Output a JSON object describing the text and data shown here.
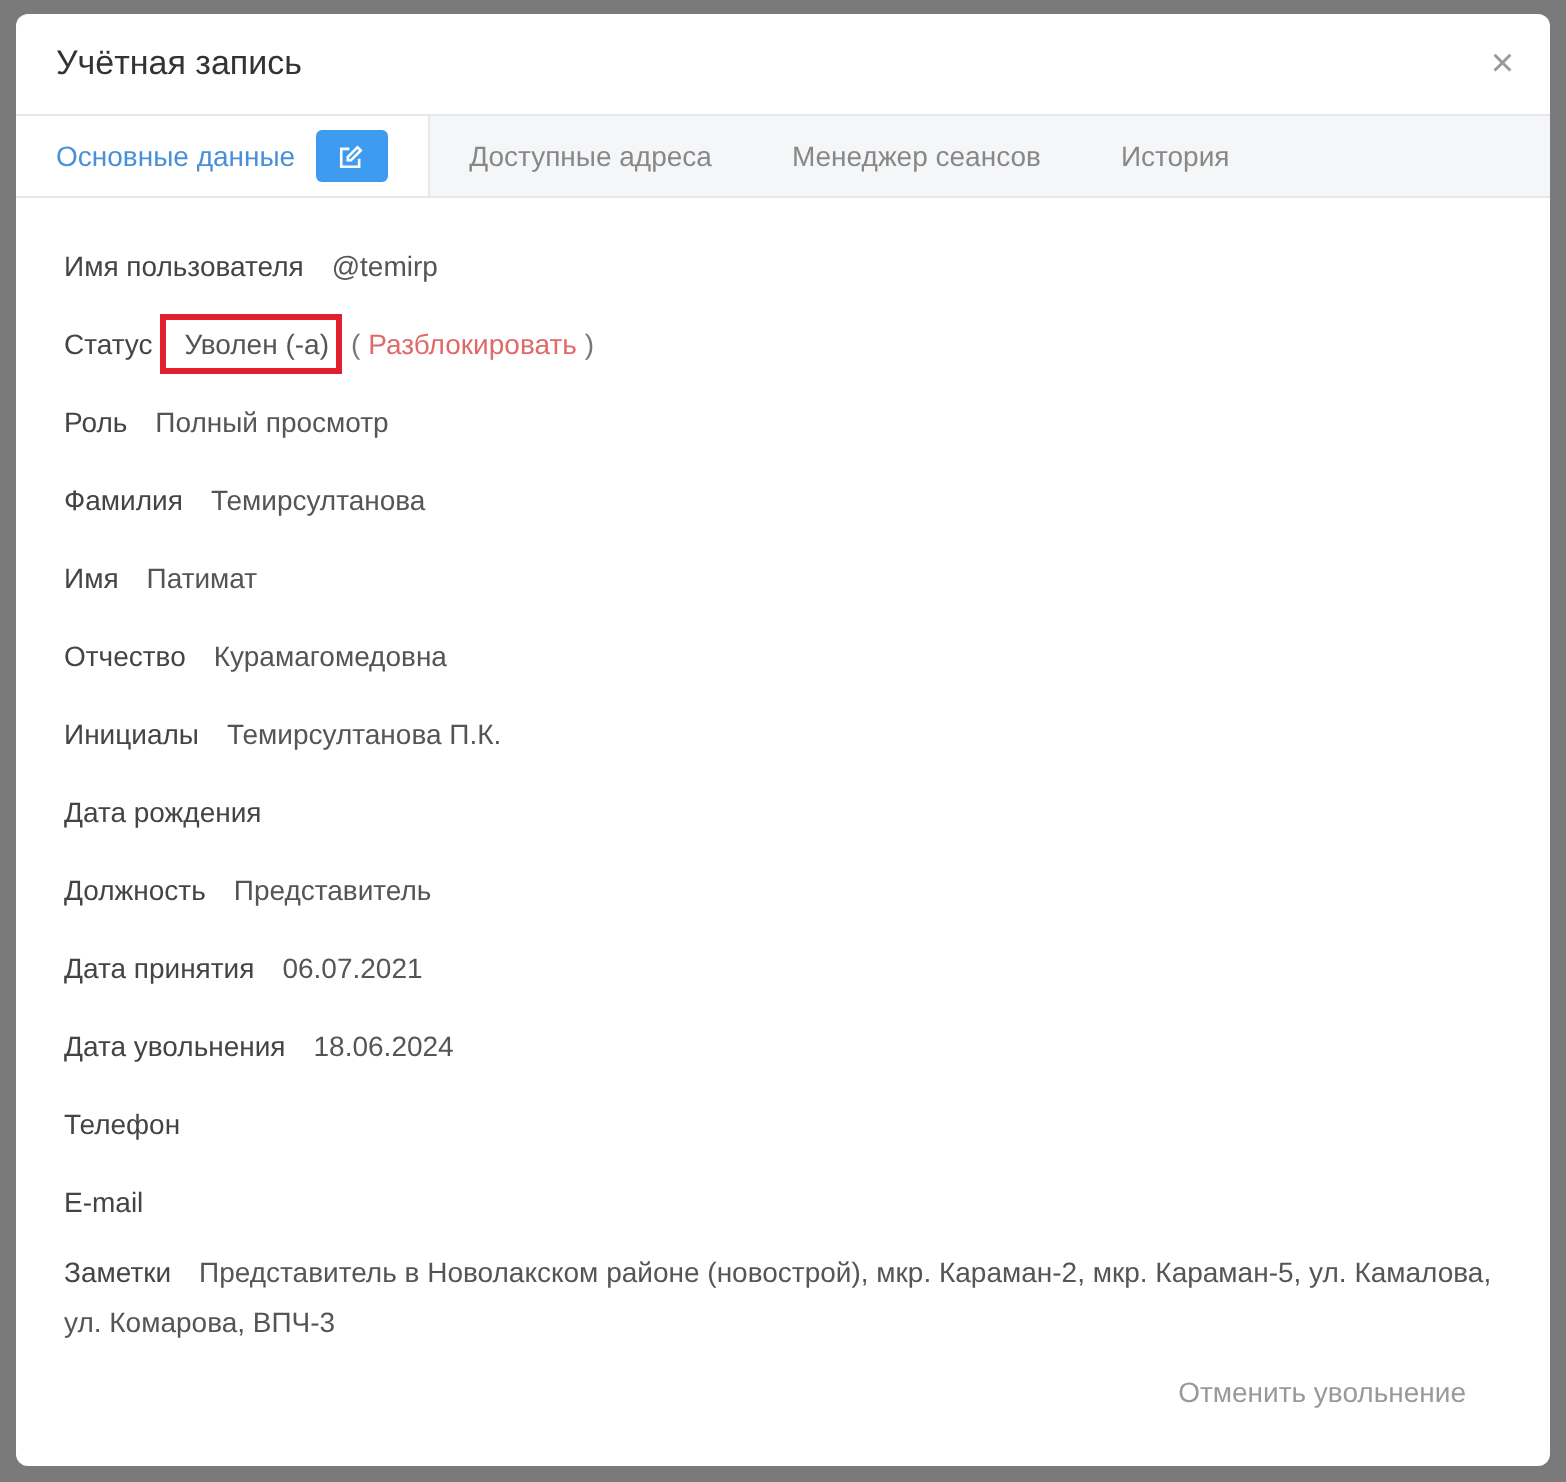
{
  "dialog": {
    "title": "Учётная запись",
    "close": "×"
  },
  "tabs": [
    {
      "label": "Основные данные",
      "selected": true,
      "editable": true
    },
    {
      "label": "Доступные адреса",
      "selected": false,
      "editable": false
    },
    {
      "label": "Менеджер сеансов",
      "selected": false,
      "editable": false
    },
    {
      "label": "История",
      "selected": false,
      "editable": false
    }
  ],
  "fields": [
    {
      "kind": "text",
      "label": "Имя пользователя",
      "value": "@temirp"
    },
    {
      "kind": "status",
      "label": "Статус",
      "value": "Уволен (-а)",
      "highlighted": true,
      "open": "(",
      "action": "Разблокировать",
      "close": ")"
    },
    {
      "kind": "text",
      "label": "Роль",
      "value": "Полный просмотр"
    },
    {
      "kind": "text",
      "label": "Фамилия",
      "value": "Темирсултанова"
    },
    {
      "kind": "text",
      "label": "Имя",
      "value": "Патимат"
    },
    {
      "kind": "text",
      "label": "Отчество",
      "value": "Курамагомедовна"
    },
    {
      "kind": "text",
      "label": "Инициалы",
      "value": "Темирсултанова П.К."
    },
    {
      "kind": "text",
      "label": "Дата рождения"
    },
    {
      "kind": "text",
      "label": "Должность",
      "value": "Представитель"
    },
    {
      "kind": "text",
      "label": "Дата принятия",
      "value": "06.07.2021"
    },
    {
      "kind": "text",
      "label": "Дата увольнения",
      "value": "18.06.2024"
    },
    {
      "kind": "text",
      "label": "Телефон"
    },
    {
      "kind": "text",
      "label": "E-mail"
    },
    {
      "kind": "text",
      "label": "Заметки",
      "value": "Представитель в Новолакском районе (новострой), мкр. Караман-2, мкр. Караман-5, ул. Камалова, ул. Комарова, ВПЧ-3"
    }
  ],
  "footer_link": "Отменить увольнение"
}
